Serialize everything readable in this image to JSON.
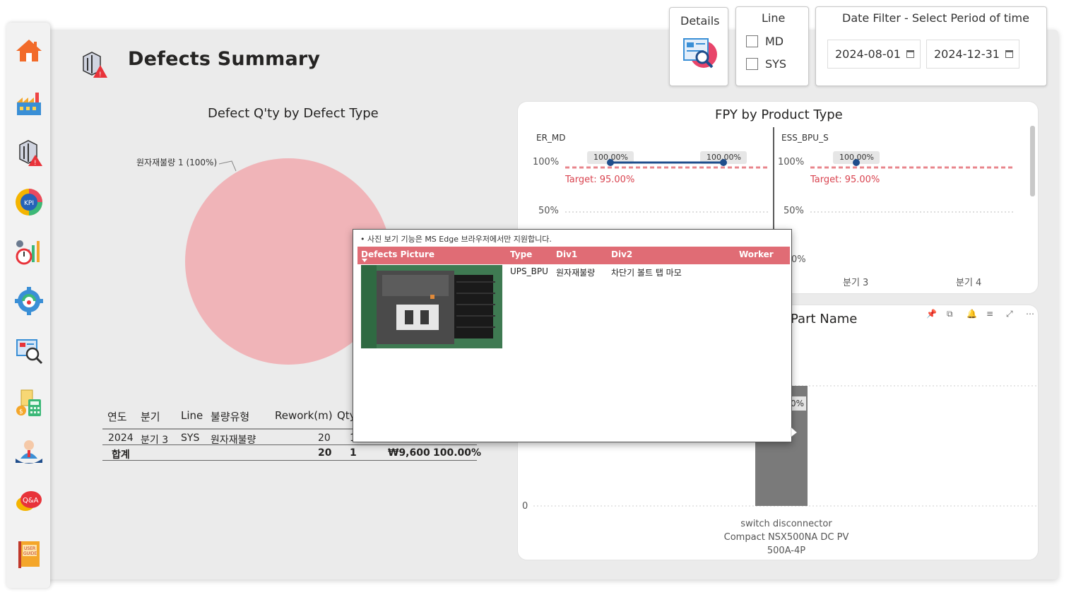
{
  "page": {
    "title": "Defects Summary"
  },
  "colors": {
    "accent": "#e06c75",
    "pie": "#f0b4b8",
    "line": "#1f4e8c",
    "target": "#e8868c",
    "bar": "#7a7a7a"
  },
  "sidebar": {
    "items": [
      {
        "icon": "home-icon"
      },
      {
        "icon": "factory-icon"
      },
      {
        "icon": "defects-icon"
      },
      {
        "icon": "kpi-icon"
      },
      {
        "icon": "performance-chart-icon"
      },
      {
        "icon": "settings-gear-icon"
      },
      {
        "icon": "search-report-icon"
      },
      {
        "icon": "cost-calculator-icon"
      },
      {
        "icon": "support-person-icon"
      },
      {
        "icon": "qna-icon"
      },
      {
        "icon": "user-guide-icon"
      }
    ],
    "qna_label": "Q&A",
    "guide_label": "USER GUIDE",
    "kpi_label": "KPI"
  },
  "filters": {
    "details_label": "Details",
    "line": {
      "title": "Line",
      "options": [
        "MD",
        "SYS"
      ]
    },
    "date": {
      "title": "Date Filter - Select Period of time",
      "start": "2024-08-01",
      "end": "2024-12-31"
    }
  },
  "pie_chart": {
    "title": "Defect Q'ty by Defect Type",
    "data_label": "원자재불량 1 (100%)"
  },
  "fpy_chart": {
    "title": "FPY by Product Type",
    "target_label": "Target: 95.00%",
    "panels": [
      {
        "name": "ER_MD",
        "point_labels": [
          "100.00%",
          "100.00%"
        ]
      },
      {
        "name": "ESS_BPU_S",
        "point_labels": [
          "100.00%"
        ]
      }
    ],
    "y_ticks": [
      "100%",
      "50%",
      "0%"
    ],
    "x_ticks": [
      "분기 3",
      "분기 4"
    ]
  },
  "part_chart": {
    "title_visible": "Part Name",
    "bar_label_visible": "0%",
    "y_tick": "0",
    "x_label": [
      "switch disconnector",
      "Compact NSX500NA DC PV",
      "500A-4P"
    ]
  },
  "table": {
    "headers": [
      "연도",
      "분기",
      "Line",
      "불량유형",
      "Rework(m)",
      "Qty"
    ],
    "row": [
      "2024",
      "분기 3",
      "SYS",
      "원자재불량",
      "20",
      "1"
    ],
    "total": {
      "label": "합계",
      "rework": "20",
      "qty": "1",
      "cost": "₩9,600",
      "pct": "100.00%"
    }
  },
  "popup": {
    "note": "• 사진 보기 기능은 MS Edge 브라우저에서만 지원합니다.",
    "headers": [
      "Defects Picture",
      "Type",
      "Div1",
      "Div2",
      "Worker"
    ],
    "row": {
      "type": "UPS_BPU",
      "div1": "원자재불량",
      "div2": "차단기 볼트 탭 마모",
      "worker": ""
    }
  },
  "chart_data": [
    {
      "type": "pie",
      "title": "Defect Q'ty by Defect Type",
      "categories": [
        "원자재불량"
      ],
      "values": [
        1
      ],
      "percentages": [
        100
      ]
    },
    {
      "type": "line",
      "title": "FPY by Product Type",
      "categories": [
        "분기 3",
        "분기 4"
      ],
      "series": [
        {
          "name": "ER_MD",
          "values": [
            100,
            100
          ]
        },
        {
          "name": "ESS_BPU_S",
          "values": [
            100,
            null
          ]
        }
      ],
      "target": 95,
      "ylim": [
        0,
        100
      ]
    },
    {
      "type": "bar",
      "title": "Part Name",
      "categories": [
        "switch disconnector Compact NSX500NA DC PV 500A-4P"
      ],
      "values": [
        1
      ]
    }
  ]
}
